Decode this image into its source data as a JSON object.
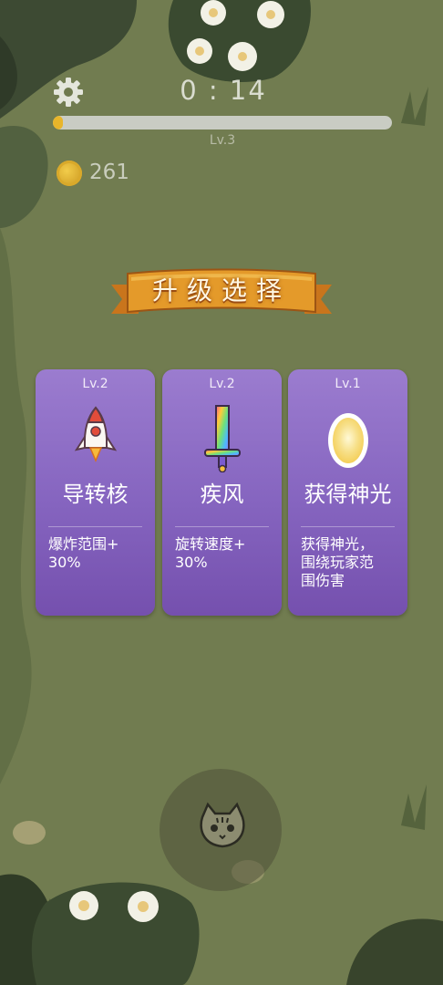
{
  "hud": {
    "timer": "0 : 14",
    "xp_progress": 0.03,
    "level": "Lv.3",
    "coins": "261"
  },
  "upgrade": {
    "title": "升级选择",
    "cards": [
      {
        "level": "Lv.2",
        "name": "导转核",
        "desc_line1": "爆炸范围+",
        "desc_line2": "30%",
        "desc_line3": "",
        "icon": "rocket-icon"
      },
      {
        "level": "Lv.2",
        "name": "疾风",
        "desc_line1": "旋转速度+",
        "desc_line2": "30%",
        "desc_line3": "",
        "icon": "rainbow-sword-icon"
      },
      {
        "level": "Lv.1",
        "name": "获得神光",
        "desc_line1": "获得神光，",
        "desc_line2": "围绕玩家范",
        "desc_line3": "围伤害",
        "icon": "glowing-orb-icon"
      }
    ]
  },
  "colors": {
    "card": "#8564bf",
    "xp_fill": "#e8b52a",
    "banner": "#e49a2a",
    "background": "#6f7a4e"
  }
}
